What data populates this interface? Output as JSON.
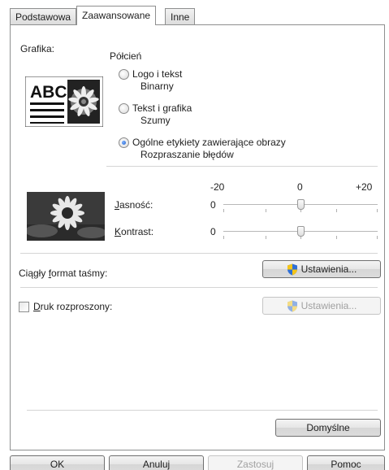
{
  "tabs": [
    {
      "label": "Podstawowa"
    },
    {
      "label": "Zaawansowane"
    },
    {
      "label": "Inne"
    }
  ],
  "graphics": {
    "label": "Grafika:",
    "group_label": "Półcień",
    "preview_text": "ABC",
    "options": [
      {
        "title": "Logo i tekst",
        "sub": "Binarny",
        "checked": false
      },
      {
        "title": "Tekst i grafika",
        "sub": "Szumy",
        "checked": false
      },
      {
        "title": "Ogólne etykiety zawierające obrazy",
        "sub": "Rozpraszanie błędów",
        "checked": true
      }
    ]
  },
  "adjust": {
    "scale_min": "-20",
    "scale_mid": "0",
    "scale_max": "+20",
    "brightness_label": "Jasność:",
    "brightness_value": "0",
    "contrast_label": "Kontrast:",
    "contrast_value": "0"
  },
  "continuous": {
    "label": "Ciągły format taśmy:",
    "button": "Ustawienia..."
  },
  "distributed": {
    "label": "Druk rozproszony:",
    "checked": false,
    "button": "Ustawienia..."
  },
  "defaults_button": "Domyślne",
  "footer": {
    "ok": "OK",
    "cancel": "Anuluj",
    "apply": "Zastosuj",
    "help": "Pomoc"
  },
  "colors": {
    "radio_selected": "#1f5fc9",
    "shield_yellow": "#f5c518",
    "shield_blue": "#2f6fd6"
  }
}
